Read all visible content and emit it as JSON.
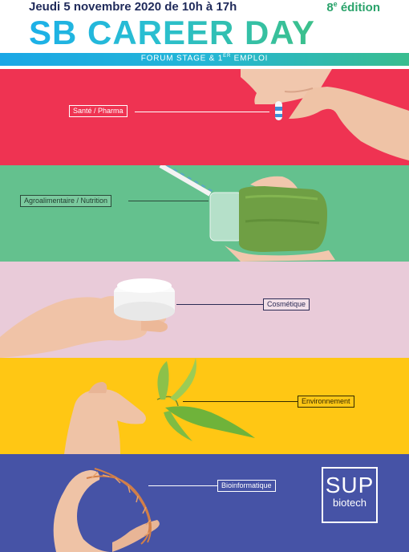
{
  "header": {
    "date": "Jeudi 5 novembre 2020 de 10h à 17h",
    "edition_number": "8",
    "edition_sup": "e",
    "edition_word": " édition",
    "title": "SB CAREER DAY",
    "ribbon_main": "FORUM STAGE & 1",
    "ribbon_sup": "ER",
    "ribbon_end": " EMPLOI"
  },
  "bands": [
    {
      "label": "Santé / Pharma",
      "color": "#ef3352"
    },
    {
      "label": "Agroalimentaire / Nutrition",
      "color": "#64c18e"
    },
    {
      "label": "Cosmétique",
      "color": "#e9cbd9"
    },
    {
      "label": "Environnement",
      "color": "#ffc714"
    },
    {
      "label": "Bioinformatique",
      "color": "#4653a6"
    }
  ],
  "logo": {
    "top": "SUP",
    "bottom": "biotech"
  },
  "icons": [
    "pill-hand-icon",
    "jar-hand-icon",
    "cream-hand-icon",
    "leaf-hand-icon",
    "dna-hand-icon"
  ]
}
